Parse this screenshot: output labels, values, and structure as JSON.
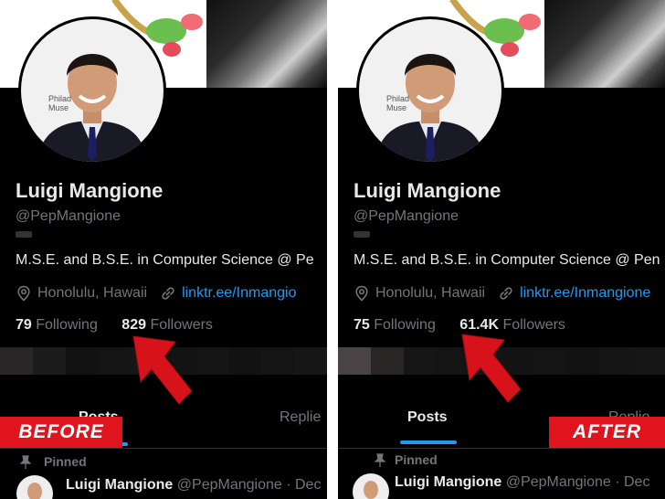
{
  "before": {
    "name": "Luigi Mangione",
    "handle": "@PepMangione",
    "bio": "M.S.E. and B.S.E. in Computer Science @ Pe",
    "location": "Honolulu, Hawaii",
    "link": "linktr.ee/Inmangio",
    "following_count": "79",
    "following_label": "Following",
    "followers_count": "829",
    "followers_label": "Followers",
    "tab_posts": "Posts",
    "tab_replies": "Replie",
    "pinned_label": "Pinned",
    "tweet_name": "Luigi Mangione",
    "tweet_handle": "@PepMangione · Dec",
    "avatar_sign": "Philad\nMuse",
    "caption": "BEFORE"
  },
  "after": {
    "name": "Luigi Mangione",
    "handle": "@PepMangione",
    "bio": "M.S.E. and B.S.E. in Computer Science @ Pen",
    "location": "Honolulu, Hawaii",
    "link": "linktr.ee/Inmangione",
    "following_count": "75",
    "following_label": "Following",
    "followers_count": "61.4K",
    "followers_label": "Followers",
    "tab_posts": "Posts",
    "tab_replies": "Replie",
    "pinned_label": "Pinned",
    "tweet_name": "Luigi Mangione",
    "tweet_handle": "@PepMangione · Dec",
    "avatar_sign": "Philad\nMuse",
    "caption": "AFTER"
  },
  "colors": {
    "accent": "#1d9bf0",
    "caption_bg": "#e0141c",
    "arrow": "#d8121a"
  },
  "icons": [
    "location-icon",
    "link-icon",
    "pin-icon",
    "arrow-icon"
  ]
}
